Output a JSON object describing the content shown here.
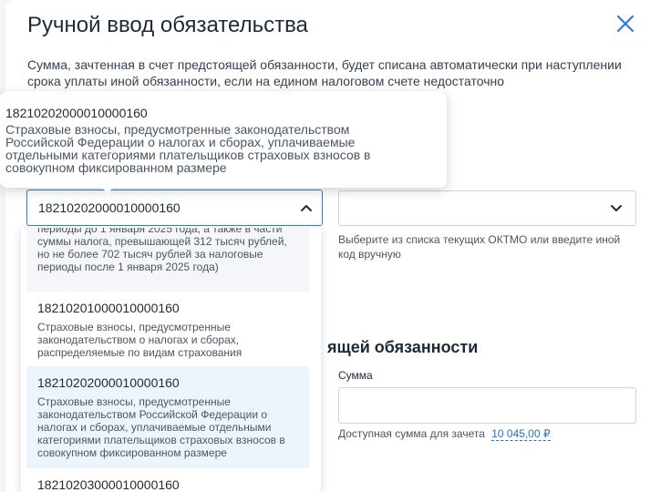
{
  "modal": {
    "title": "Ручной ввод обязательства",
    "description": "Сумма, зачтенная в счет предстоящей обязанности, будет списана автоматически при наступлении срока уплаты иной обязанности, если на едином налоговом счете недостаточно"
  },
  "kbk_field": {
    "value": "18210202000010000160"
  },
  "oktmo_field": {
    "value": "",
    "hint": "Выберите из списка текущих ОКТМО или введите иной код вручную"
  },
  "section": {
    "heading": "ящей обязанности"
  },
  "sum_field": {
    "label": "Сумма",
    "value": "",
    "available_label": "Доступная сумма для зачета",
    "available_amount": "10 045,00 ₽"
  },
  "dropdown": {
    "options": [
      {
        "code": "",
        "text": "периоды до 1 января 2025 года, а также в части суммы налога, превышающей 312 тысяч рублей, но не более 702 тысяч рублей за налоговые периоды после 1 января 2025 года)"
      },
      {
        "code": "18210201000010000160",
        "text": "Страховые взносы, предусмотренные законодательством о налогах и сборах, распределяемые по видам страхования"
      },
      {
        "code": "18210202000010000160",
        "text": "Страховые взносы, предусмотренные законодательством Российской Федерации о налогах и сборах, уплачиваемые отдельными категориями плательщиков страховых взносов в совокупном фиксированном размере",
        "selected": true
      },
      {
        "code": "18210203000010000160",
        "text": ""
      }
    ]
  },
  "tooltip": {
    "code": "18210202000010000160",
    "text": "Страховые взносы, предусмотренные законодательством Российской Федерации о налогах и сборах, уплачиваемые отдельными категориями плательщиков страховых взносов в совокупном фиксированном размере"
  },
  "icons": {
    "close": "close-icon",
    "kbk_chevron": "chevron-up-icon",
    "oktmo_chevron": "chevron-down-icon"
  },
  "colors": {
    "accent": "#2e7cd6",
    "link": "#2e6fc0",
    "text": "#1f2a37",
    "muted": "#4b5563"
  }
}
